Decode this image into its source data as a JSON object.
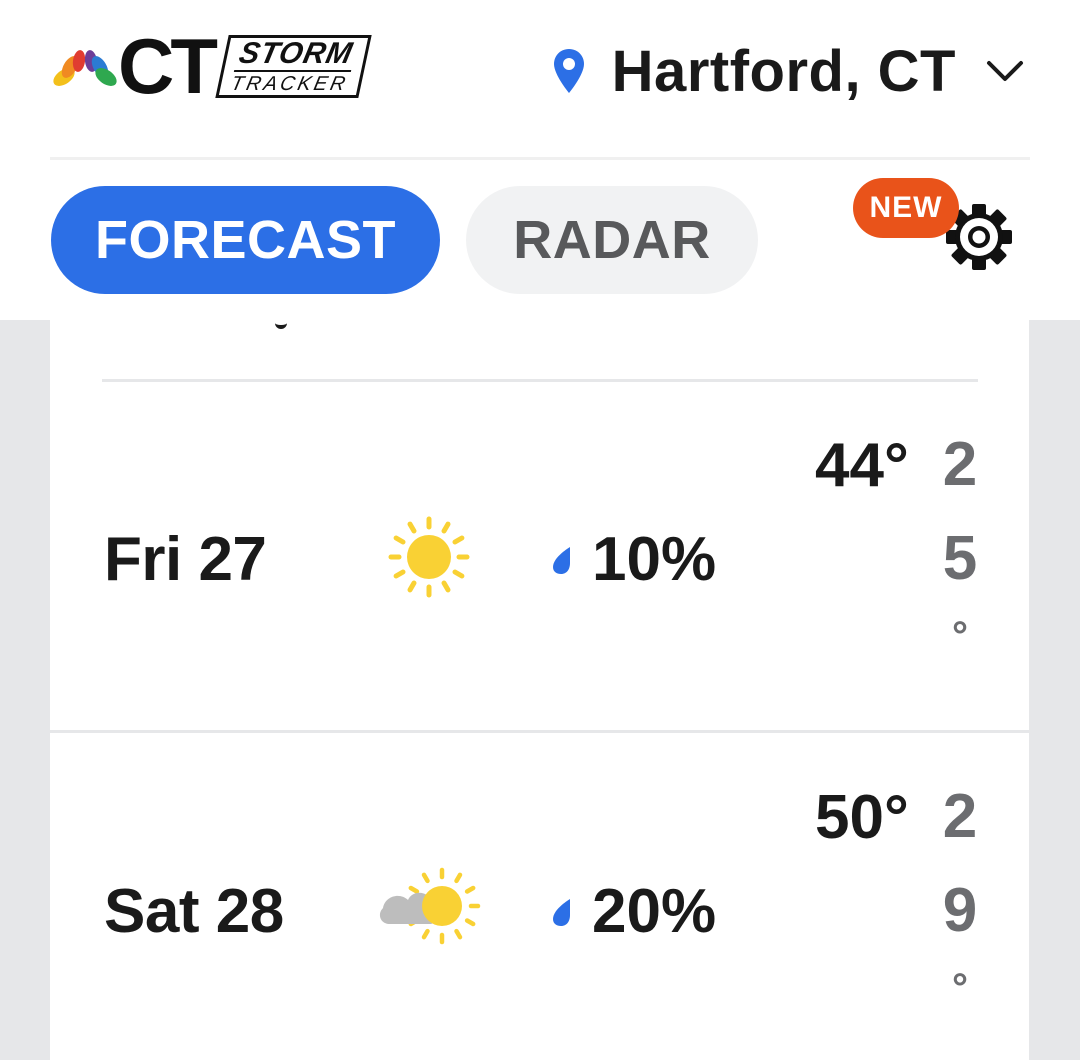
{
  "header": {
    "logo": {
      "ct_text": "CT",
      "storm_text": "STORM",
      "tracker_text": "TRACKER"
    },
    "location": {
      "city": "Hartford, CT",
      "pin_icon": "location-pin-icon",
      "dropdown_icon": "chevron-down-icon"
    }
  },
  "tabs": [
    {
      "label": "FORECAST",
      "active": true
    },
    {
      "label": "RADAR",
      "active": false
    }
  ],
  "settings": {
    "badge": "NEW",
    "icon": "gear-icon"
  },
  "colors": {
    "accent": "#2c6fe6",
    "badge": "#e9531a",
    "drop": "#2c6fe6",
    "sun": "#f9d134",
    "cloud": "#bdbdbd"
  },
  "forecast": [
    {
      "day": "Fri 27",
      "condition_icon": "sun-icon",
      "precip": "10%",
      "high": "44°",
      "low_digits": [
        "2",
        "5"
      ],
      "low_degree": "°"
    },
    {
      "day": "Sat 28",
      "condition_icon": "partly-cloudy-icon",
      "precip": "20%",
      "high": "50°",
      "low_digits": [
        "2",
        "9"
      ],
      "low_degree": "°"
    }
  ]
}
